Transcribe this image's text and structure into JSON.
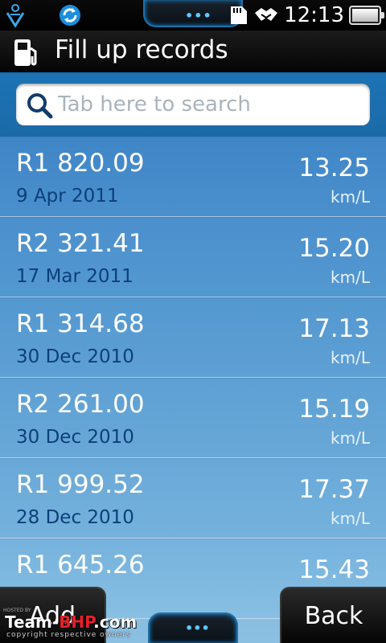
{
  "status_bar": {
    "time": "12:13",
    "center_handle": "•••"
  },
  "header": {
    "title": "Fill up records"
  },
  "search": {
    "placeholder": "Tab here to search"
  },
  "records": [
    {
      "amount": "R1 820.09",
      "date": "9 Apr 2011",
      "efficiency": "13.25",
      "unit": "km/L"
    },
    {
      "amount": "R2 321.41",
      "date": "17 Mar 2011",
      "efficiency": "15.20",
      "unit": "km/L"
    },
    {
      "amount": "R1 314.68",
      "date": "30 Dec 2010",
      "efficiency": "17.13",
      "unit": "km/L"
    },
    {
      "amount": "R2 261.00",
      "date": "30 Dec 2010",
      "efficiency": "15.19",
      "unit": "km/L"
    },
    {
      "amount": "R1 999.52",
      "date": "28 Dec 2010",
      "efficiency": "17.37",
      "unit": "km/L"
    },
    {
      "amount": "R1 645.26",
      "date": "",
      "efficiency": "15.43",
      "unit": ""
    }
  ],
  "softkeys": {
    "left": "Add",
    "right": "Back",
    "center_handle": "•••"
  },
  "watermark": {
    "hosted": "HOSTED BY",
    "brand_prefix": "Team-",
    "brand_highlight": "BHP",
    "brand_suffix": ".com",
    "copyright": "copyright respective owners"
  },
  "colors": {
    "accent": "#1d73b4",
    "date_text": "#0d3f7a",
    "brand_red": "#e8202a"
  }
}
